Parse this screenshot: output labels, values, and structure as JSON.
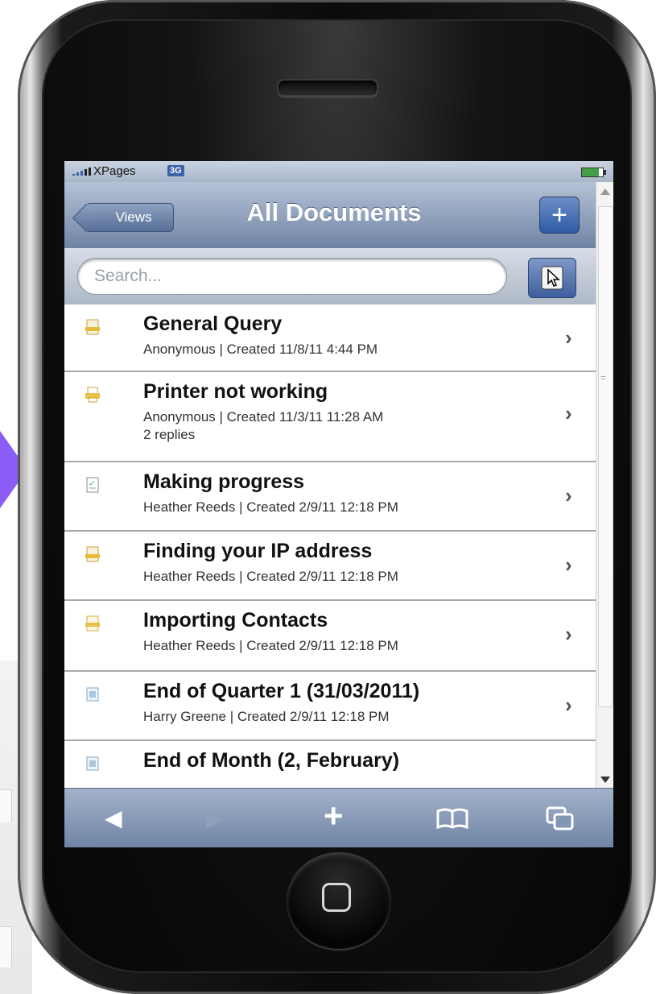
{
  "status_bar": {
    "carrier": "XPages",
    "network": "3G"
  },
  "nav": {
    "back_label": "Views",
    "title": "All Documents",
    "add_label": "+"
  },
  "search": {
    "placeholder": "Search..."
  },
  "documents": [
    {
      "title": "General Query",
      "meta": "Anonymous | Created 11/8/11 4:44 PM",
      "replies": "",
      "icon": "document-icon",
      "icon_color": "#e8b83a"
    },
    {
      "title": "Printer not working",
      "meta": "Anonymous | Created 11/3/11 11:28 AM",
      "replies": "2 replies",
      "icon": "printer-icon",
      "icon_color": "#e8c04a"
    },
    {
      "title": "Making progress",
      "meta": "Heather Reeds | Created 2/9/11 12:18 PM",
      "replies": "",
      "icon": "checklist-icon",
      "icon_color": "#8a8a8a"
    },
    {
      "title": "Finding your IP address",
      "meta": "Heather Reeds | Created 2/9/11 12:18 PM",
      "replies": "",
      "icon": "document-icon",
      "icon_color": "#e8b83a"
    },
    {
      "title": "Importing Contacts",
      "meta": "Heather Reeds | Created 2/9/11 12:18 PM",
      "replies": "",
      "icon": "document-icon",
      "icon_color": "#e8c04a"
    },
    {
      "title": "End of Quarter 1 (31/03/2011)",
      "meta": "Harry Greene | Created 2/9/11 12:18 PM",
      "replies": "",
      "icon": "calendar-icon",
      "icon_color": "#7fa9c9"
    },
    {
      "title": "End of Month (2, February)",
      "meta": "",
      "replies": "",
      "icon": "calendar-icon",
      "icon_color": "#7fa9c9"
    }
  ],
  "toolbar": {
    "back": "◀",
    "forward": "▶",
    "add": "+",
    "bookmarks": "bookmarks-icon",
    "pages": "pages-icon"
  },
  "colors": {
    "nav_top": "#b5c2d6",
    "nav_bottom": "#6f84a4",
    "accent_button": "#2e5ba6"
  }
}
